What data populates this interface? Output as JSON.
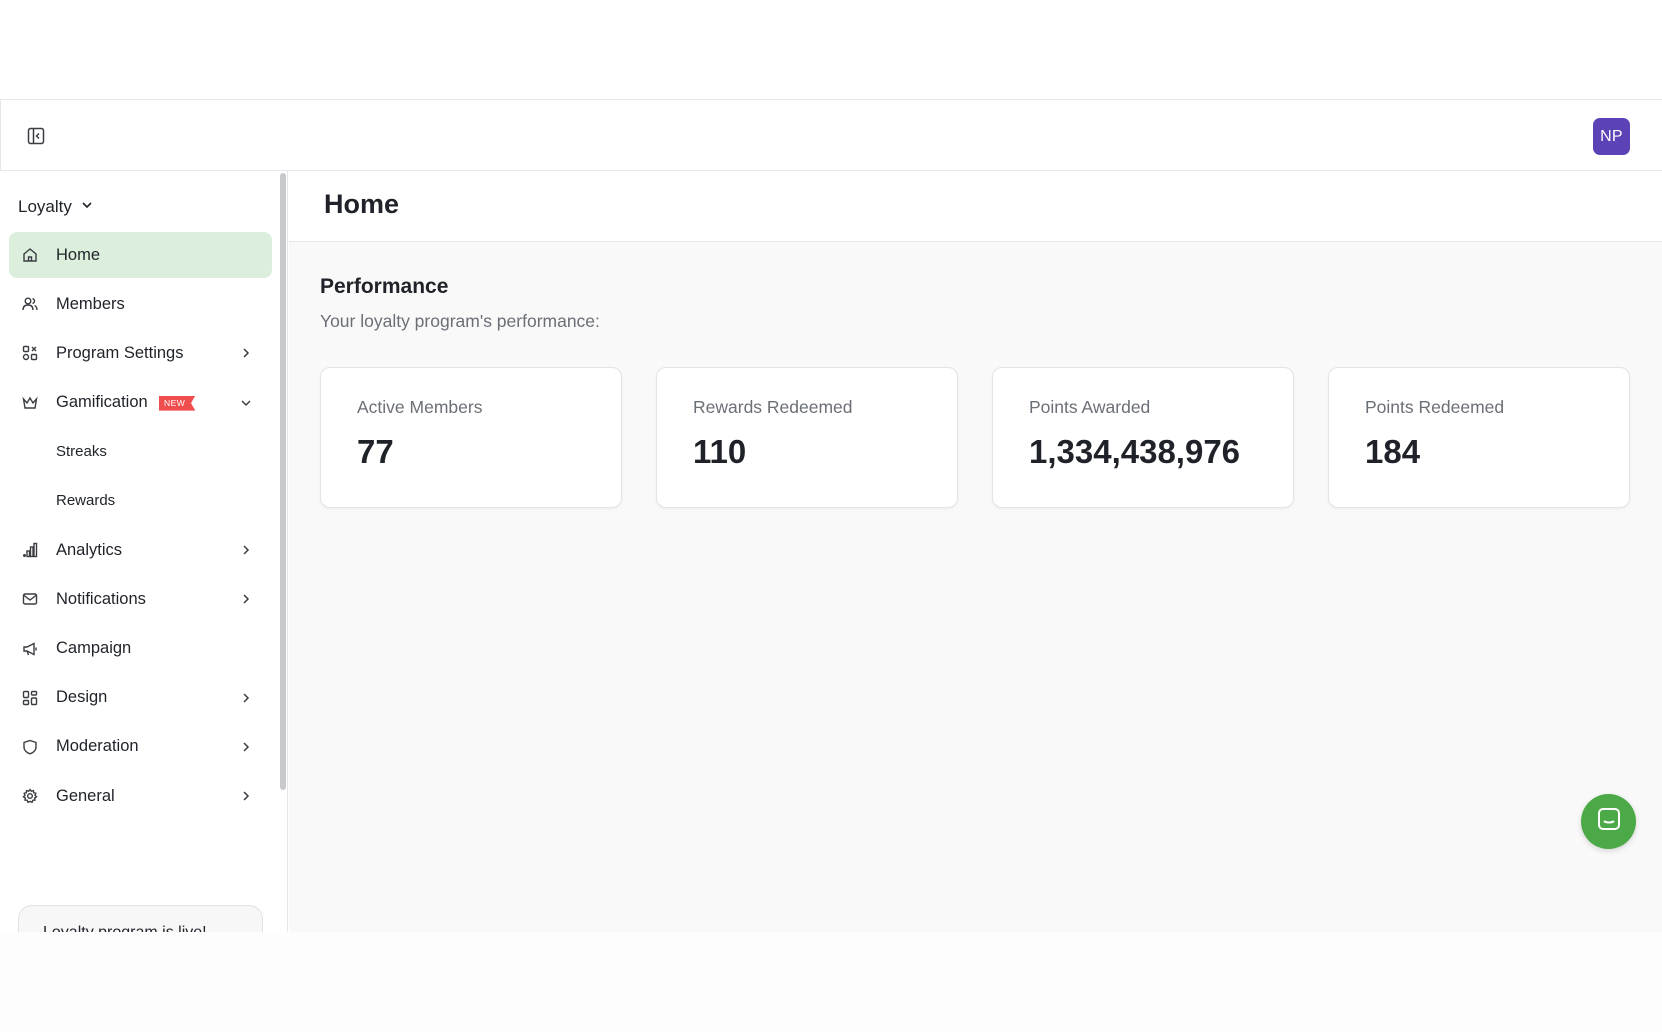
{
  "topbar": {
    "toggle_icon": "sidebar-collapse-icon",
    "avatar_initials": "NP",
    "avatar_color": "#5b43b7"
  },
  "sidebar": {
    "program_selector": "Loyalty",
    "items": [
      {
        "label": "Home",
        "icon": "home-icon",
        "active": true
      },
      {
        "label": "Members",
        "icon": "users-icon"
      },
      {
        "label": "Program Settings",
        "icon": "settings-grid-icon",
        "chevron": "right"
      },
      {
        "label": "Gamification",
        "icon": "crown-icon",
        "chevron": "down",
        "badge": "NEW"
      },
      {
        "label": "Streaks",
        "sub": true
      },
      {
        "label": "Rewards",
        "sub": true
      },
      {
        "label": "Analytics",
        "icon": "bar-chart-icon",
        "chevron": "right"
      },
      {
        "label": "Notifications",
        "icon": "mail-icon",
        "chevron": "right"
      },
      {
        "label": "Campaign",
        "icon": "megaphone-icon"
      },
      {
        "label": "Design",
        "icon": "layout-icon",
        "chevron": "right"
      },
      {
        "label": "Moderation",
        "icon": "shield-icon",
        "chevron": "right"
      },
      {
        "label": "General",
        "icon": "gear-icon",
        "chevron": "right"
      }
    ],
    "promo_text": "Loyalty program is live!",
    "active_color": "#dcefdc",
    "badge_color": "#f04e4e"
  },
  "main": {
    "page_title": "Home",
    "section_title": "Performance",
    "section_subtitle": "Your loyalty program's performance:",
    "stats": [
      {
        "label": "Active Members",
        "value": "77"
      },
      {
        "label": "Rewards Redeemed",
        "value": "110"
      },
      {
        "label": "Points Awarded",
        "value": "1,334,438,976"
      },
      {
        "label": "Points Redeemed",
        "value": "184"
      }
    ]
  },
  "chat": {
    "icon": "chat-bubble-icon",
    "color": "#4ba947"
  }
}
